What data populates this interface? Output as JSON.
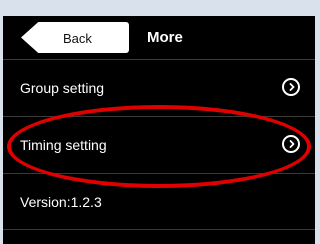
{
  "navbar": {
    "back_label": "Back",
    "title": "More"
  },
  "menu": {
    "items": [
      {
        "label": "Group setting",
        "icon": "chevron-right-circle-icon"
      },
      {
        "label": "Timing setting",
        "icon": "chevron-right-circle-icon"
      },
      {
        "label": "Version:1.2.3"
      }
    ]
  },
  "colors": {
    "background": "#000000",
    "text": "#ffffff",
    "back_button": "#ffffff",
    "annotation": "#e00000"
  }
}
